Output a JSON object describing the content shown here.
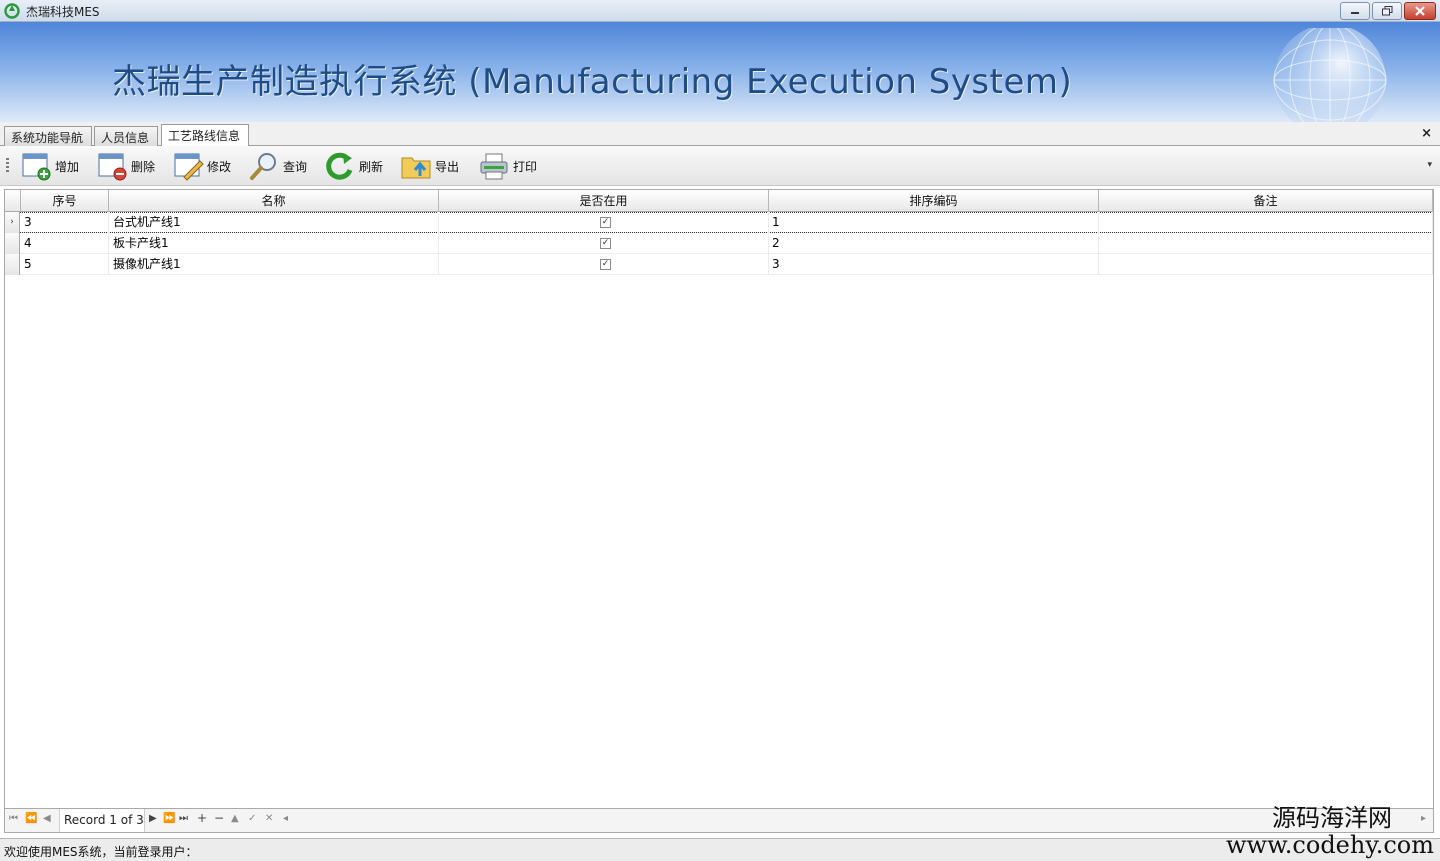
{
  "window": {
    "title": "杰瑞科技MES",
    "buttons": [
      "minimize",
      "restore",
      "close"
    ]
  },
  "banner": {
    "title": "杰瑞生产制造执行系统 (Manufacturing Execution System)"
  },
  "tabs": [
    {
      "label": "系统功能导航",
      "active": false
    },
    {
      "label": "人员信息",
      "active": false
    },
    {
      "label": "工艺路线信息",
      "active": true
    }
  ],
  "tab_close": "×",
  "toolbar": {
    "add": "增加",
    "delete": "删除",
    "edit": "修改",
    "query": "查询",
    "refresh": "刷新",
    "export": "导出",
    "print": "打印"
  },
  "grid": {
    "columns": [
      "序号",
      "名称",
      "是否在用",
      "排序编码",
      "备注"
    ],
    "rows": [
      {
        "seq": "3",
        "name": "台式机产线1",
        "in_use": true,
        "sort_code": "1",
        "remark": ""
      },
      {
        "seq": "4",
        "name": "板卡产线1",
        "in_use": true,
        "sort_code": "2",
        "remark": ""
      },
      {
        "seq": "5",
        "name": "摄像机产线1",
        "in_use": true,
        "sort_code": "3",
        "remark": ""
      }
    ],
    "current_row_marker": "›"
  },
  "navigator": {
    "record_text": "Record 1 of 3"
  },
  "status": {
    "text": "欢迎使用MES系统，当前登录用户："
  },
  "watermark": {
    "line1": "源码海洋网",
    "line2": "www.codehy.com"
  },
  "colors": {
    "banner_title": "#1e4c86",
    "banner_top": "#4f86d9",
    "refresh_green": "#2e9b2e"
  }
}
